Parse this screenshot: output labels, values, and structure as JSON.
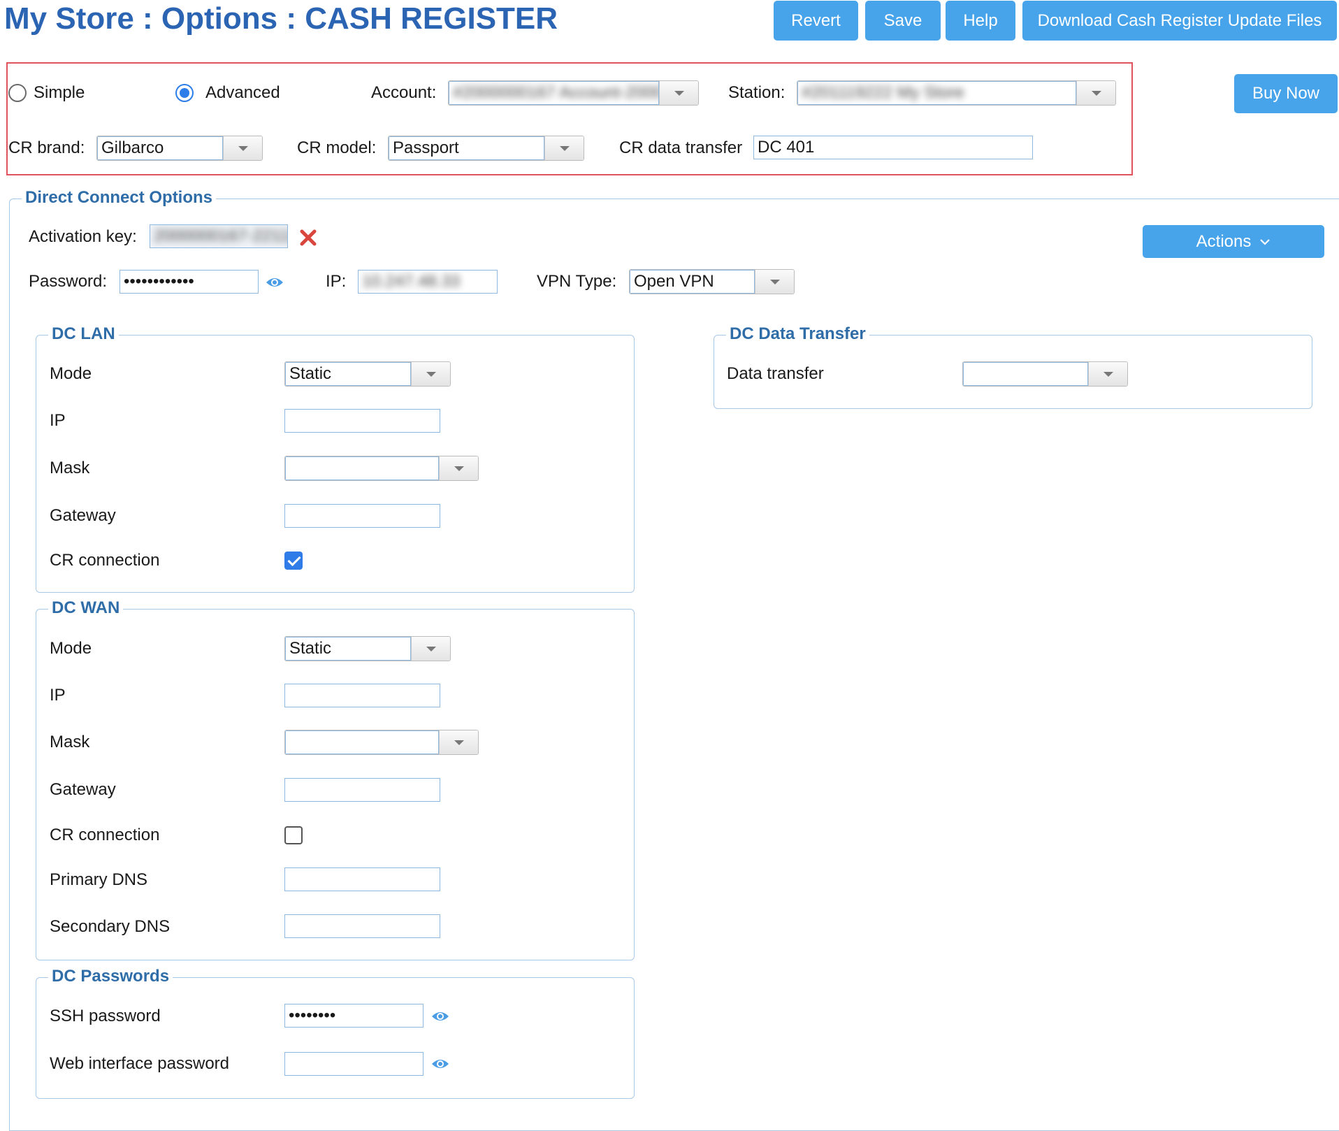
{
  "header": {
    "title": "My Store : Options : CASH REGISTER",
    "buttons": {
      "revert": "Revert",
      "save": "Save",
      "help": "Help",
      "download": "Download Cash Register Update Files"
    },
    "buy_now": "Buy Now"
  },
  "mode": {
    "simple_label": "Simple",
    "advanced_label": "Advanced",
    "selected": "Advanced"
  },
  "account": {
    "label": "Account:",
    "value": "#2000000167 Account-2000"
  },
  "station": {
    "label": "Station:",
    "value": "#201119222 My Store"
  },
  "cr_brand": {
    "label": "CR brand:",
    "value": "Gilbarco"
  },
  "cr_model": {
    "label": "CR model:",
    "value": "Passport"
  },
  "cr_data_transfer": {
    "label": "CR data transfer",
    "value": "DC 401"
  },
  "direct_connect": {
    "legend": "Direct Connect Options",
    "activation_key": {
      "label": "Activation key:",
      "value": "2000000167-22111"
    },
    "password": {
      "label": "Password:",
      "value": "••••••••••••"
    },
    "ip": {
      "label": "IP:",
      "value": "10.247.48.33"
    },
    "vpn_type": {
      "label": "VPN Type:",
      "value": "Open VPN"
    },
    "actions_label": "Actions"
  },
  "dc_lan": {
    "legend": "DC LAN",
    "mode": {
      "label": "Mode",
      "value": "Static"
    },
    "ip": {
      "label": "IP",
      "value": ""
    },
    "mask": {
      "label": "Mask",
      "value": ""
    },
    "gateway": {
      "label": "Gateway",
      "value": ""
    },
    "cr_connection": {
      "label": "CR connection",
      "checked": true
    }
  },
  "dc_wan": {
    "legend": "DC WAN",
    "mode": {
      "label": "Mode",
      "value": "Static"
    },
    "ip": {
      "label": "IP",
      "value": ""
    },
    "mask": {
      "label": "Mask",
      "value": ""
    },
    "gateway": {
      "label": "Gateway",
      "value": ""
    },
    "cr_connection": {
      "label": "CR connection",
      "checked": false
    },
    "primary_dns": {
      "label": "Primary DNS",
      "value": ""
    },
    "secondary_dns": {
      "label": "Secondary DNS",
      "value": ""
    }
  },
  "dc_passwords": {
    "legend": "DC Passwords",
    "ssh": {
      "label": "SSH password",
      "value": "••••••••"
    },
    "web": {
      "label": "Web interface password",
      "value": ""
    }
  },
  "dc_data_transfer": {
    "legend": "DC Data Transfer",
    "data_transfer": {
      "label": "Data transfer",
      "value": ""
    }
  },
  "colors": {
    "accent": "#47a3ea",
    "title": "#2b64b3",
    "legend": "#2f6da9",
    "highlight_border": "#e0535e"
  }
}
